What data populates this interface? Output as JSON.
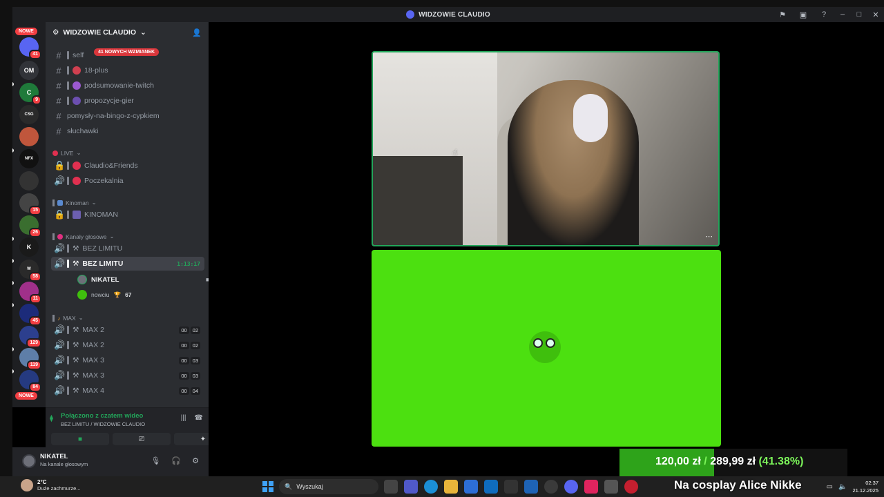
{
  "window": {
    "title": "WIDZOWIE CLAUDIO"
  },
  "guilds": {
    "new_top": "NOWE",
    "new_bottom": "NOWE",
    "om_label": "OM",
    "badges": [
      "41",
      "9",
      "15",
      "26",
      "58",
      "11",
      "45",
      "129",
      "119",
      "84"
    ]
  },
  "server": {
    "name": "WIDZOWIE CLAUDIO",
    "mentions_pill": "41 NOWYCH WZMIANEK"
  },
  "channels": {
    "self": "self",
    "c18": "18-plus",
    "podsumowanie": "podsumowanie-twitch",
    "propozycje": "propozycje-gier",
    "pomysly": "pomysły-na-bingo-z-cypkiem",
    "sluchawki": "słuchawki",
    "cat_live": "LIVE",
    "friends": "Claudio&Friends",
    "poczekalnia": "Poczekalnia",
    "cat_kinoman": "Kinoman",
    "kinoman": "KINOMAN",
    "cat_kanaly": "Kanały głosowe",
    "bez_limitu_1": "BEZ LIMITU",
    "bez_limitu_2": "BEZ LIMITU",
    "timer": "1:13:17",
    "user1": "NIKATEL",
    "user2": "nowciu",
    "user2_badge": "67",
    "cat_max": "MAX",
    "max": [
      {
        "name": "MAX 2",
        "a": "00",
        "b": "02"
      },
      {
        "name": "MAX 2",
        "a": "00",
        "b": "02"
      },
      {
        "name": "MAX 3",
        "a": "00",
        "b": "03"
      },
      {
        "name": "MAX 3",
        "a": "00",
        "b": "03"
      },
      {
        "name": "MAX 4",
        "a": "00",
        "b": "04"
      }
    ]
  },
  "voice": {
    "status": "Połączono z czatem wideo",
    "sub": "BEZ LIMITU / WIDZOWIE CLAUDIO"
  },
  "user_panel": {
    "name": "NIKATEL",
    "status": "Na kanale głosowym"
  },
  "donation": {
    "amount": "120,00 zł",
    "sep": "/",
    "goal": "289,99 zł",
    "pct": "(41.38%)",
    "fill": 0.4138
  },
  "overlay": {
    "cosplay": "Na cosplay Alice Nikke"
  },
  "taskbar": {
    "temp": "2°C",
    "weather": "Duże zachmurze...",
    "search": "Wyszukaj",
    "time": "02:37",
    "date": "21.12.2025"
  }
}
